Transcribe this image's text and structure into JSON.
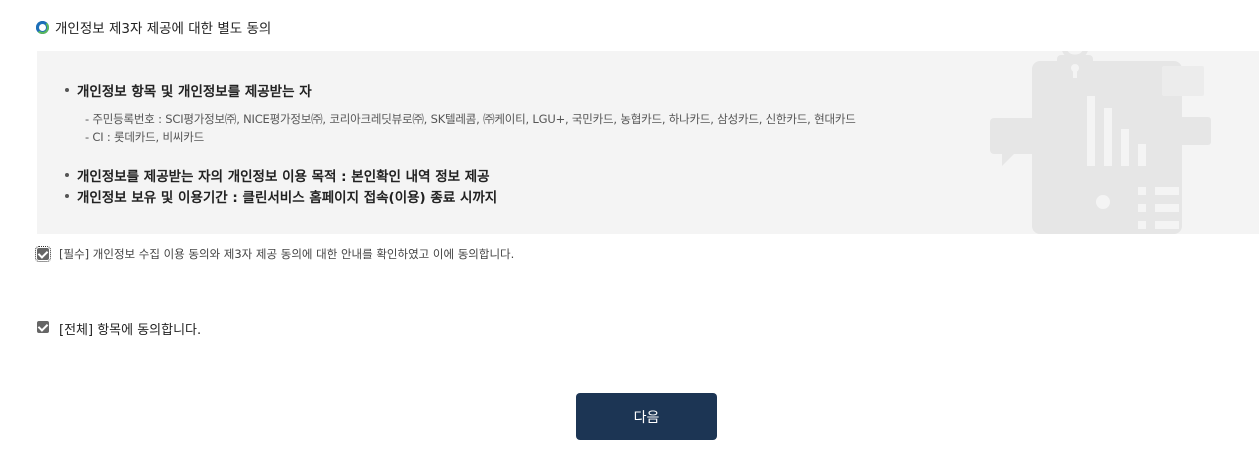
{
  "section": {
    "title": "개인정보 제3자 제공에 대한 별도 동의"
  },
  "info": {
    "recipients_heading": "개인정보 항목 및 개인정보를 제공받는 자",
    "recipients_line1": "- 주민등록번호 : SCI평가정보㈜, NICE평가정보㈜, 코리아크레딧뷰로㈜, SK텔레콤, ㈜케이티, LGU+, 국민카드, 농협카드, 하나카드, 삼성카드, 신한카드, 현대카드",
    "recipients_line2": "- CI : 롯데카드, 비씨카드",
    "purpose": "개인정보를 제공받는 자의 개인정보 이용 목적 : 본인확인 내역 정보 제공",
    "retention": "개인정보 보유 및 이용기간 : 클린서비스 홈페이지 접속(이용) 종료 시까지"
  },
  "consent": {
    "required_label": "[필수] 개인정보 수집 이용 동의와 제3자 제공 동의에 대한 안내를 확인하였고 이에 동의합니다.",
    "required_checked": true,
    "all_label": "[전체] 항목에 동의합니다.",
    "all_checked": true
  },
  "actions": {
    "next_label": "다음"
  },
  "colors": {
    "button_bg": "#1c3554",
    "info_box_bg": "#f4f4f4",
    "title_icon": "#1d6fb8"
  },
  "icons": {
    "title": "circle-bullet-icon",
    "illustration": "privacy-document-illustration",
    "checkbox": "checkbox-checked-icon"
  }
}
